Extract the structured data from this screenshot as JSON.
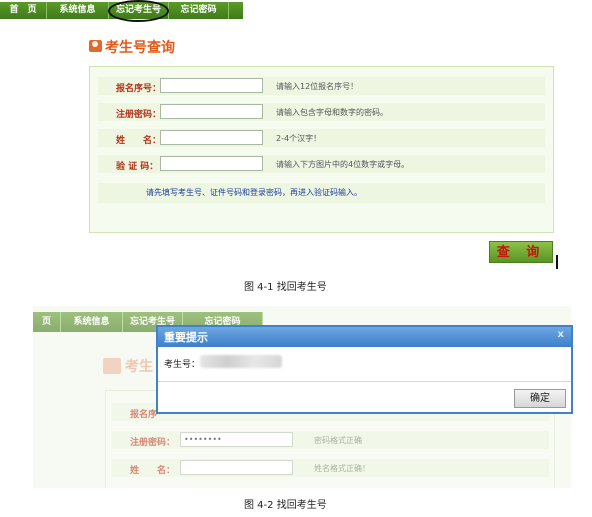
{
  "screenshot1": {
    "nav": [
      "首　页",
      "系统信息",
      "忘记考生号",
      "忘记密码"
    ],
    "title": "考生号查询",
    "form": [
      {
        "label": "报名序号：",
        "hint": "请输入12位报名序号！"
      },
      {
        "label": "注册密码：",
        "hint": "请输入包含字母和数字的密码。"
      },
      {
        "label": "姓　　名：",
        "hint": "2-4个汉字！"
      },
      {
        "label": "验 证 码：",
        "hint": "请输入下方图片中的4位数字或字母。"
      }
    ],
    "note": "请先填写考生号、证件号码和登录密码，再进入验证码输入。",
    "query_button": "查  询"
  },
  "caption1": "图 4-1  找回考生号",
  "screenshot2": {
    "nav": [
      "页",
      "系统信息",
      "忘记考生号",
      "忘记密码"
    ],
    "title": "考生",
    "form": [
      {
        "label": "报名序",
        "value": "",
        "hint": ""
      },
      {
        "label": "注册密码：",
        "value": "••••••••",
        "hint": "密码格式正确"
      },
      {
        "label": "姓　　名：",
        "value": "",
        "hint": "姓名格式正确！"
      }
    ],
    "dialog": {
      "title": "重要提示",
      "close": "x",
      "field_label": "考生号：",
      "ok_button": "确定"
    }
  },
  "caption2": "图 4-2  找回考生号"
}
